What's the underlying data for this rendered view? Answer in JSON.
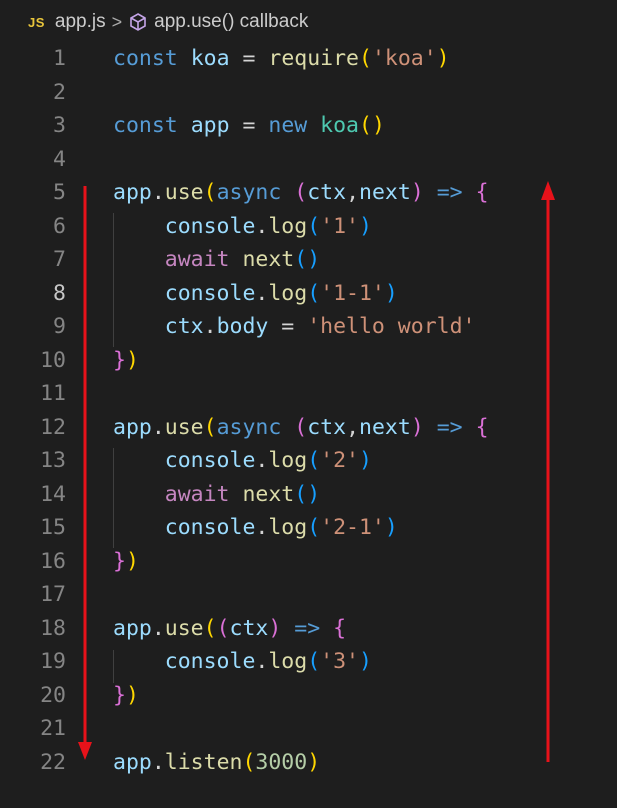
{
  "breadcrumb": {
    "language_badge": "JS",
    "file": "app.js",
    "separator": ">",
    "symbol": "app.use() callback",
    "symbol_icon": "cube-icon"
  },
  "lines": [
    {
      "n": "1",
      "active": false,
      "tokens": [
        [
          "kw",
          "const"
        ],
        [
          "plain",
          " "
        ],
        [
          "var",
          "koa"
        ],
        [
          "plain",
          " = "
        ],
        [
          "fn",
          "require"
        ],
        [
          "p1",
          "("
        ],
        [
          "str",
          "'koa'"
        ],
        [
          "p1",
          ")"
        ]
      ]
    },
    {
      "n": "2",
      "active": false,
      "tokens": []
    },
    {
      "n": "3",
      "active": false,
      "tokens": [
        [
          "kw",
          "const"
        ],
        [
          "plain",
          " "
        ],
        [
          "var",
          "app"
        ],
        [
          "plain",
          " = "
        ],
        [
          "kw",
          "new"
        ],
        [
          "plain",
          " "
        ],
        [
          "cls",
          "koa"
        ],
        [
          "p1",
          "()"
        ]
      ]
    },
    {
      "n": "4",
      "active": false,
      "tokens": []
    },
    {
      "n": "5",
      "active": false,
      "tokens": [
        [
          "var",
          "app"
        ],
        [
          "plain",
          "."
        ],
        [
          "fn",
          "use"
        ],
        [
          "p1",
          "("
        ],
        [
          "kw",
          "async"
        ],
        [
          "plain",
          " "
        ],
        [
          "p2",
          "("
        ],
        [
          "var",
          "ctx"
        ],
        [
          "plain",
          ","
        ],
        [
          "var",
          "next"
        ],
        [
          "p2",
          ")"
        ],
        [
          "plain",
          " "
        ],
        [
          "kw",
          "=>"
        ],
        [
          "plain",
          " "
        ],
        [
          "p2",
          "{"
        ]
      ]
    },
    {
      "n": "6",
      "active": false,
      "tokens": [
        [
          "plain",
          "    "
        ],
        [
          "var",
          "console"
        ],
        [
          "plain",
          "."
        ],
        [
          "fn",
          "log"
        ],
        [
          "p3",
          "("
        ],
        [
          "str",
          "'1'"
        ],
        [
          "p3",
          ")"
        ]
      ]
    },
    {
      "n": "7",
      "active": false,
      "tokens": [
        [
          "plain",
          "    "
        ],
        [
          "kw2",
          "await"
        ],
        [
          "plain",
          " "
        ],
        [
          "fn",
          "next"
        ],
        [
          "p3",
          "()"
        ]
      ]
    },
    {
      "n": "8",
      "active": true,
      "tokens": [
        [
          "plain",
          "    "
        ],
        [
          "var",
          "console"
        ],
        [
          "plain",
          "."
        ],
        [
          "fn",
          "log"
        ],
        [
          "p3",
          "("
        ],
        [
          "str",
          "'1-1'"
        ],
        [
          "p3",
          ")"
        ]
      ]
    },
    {
      "n": "9",
      "active": false,
      "tokens": [
        [
          "plain",
          "    "
        ],
        [
          "var",
          "ctx"
        ],
        [
          "plain",
          "."
        ],
        [
          "var",
          "body"
        ],
        [
          "plain",
          " = "
        ],
        [
          "str",
          "'hello world'"
        ]
      ]
    },
    {
      "n": "10",
      "active": false,
      "tokens": [
        [
          "p2",
          "}"
        ],
        [
          "p1",
          ")"
        ]
      ]
    },
    {
      "n": "11",
      "active": false,
      "tokens": []
    },
    {
      "n": "12",
      "active": false,
      "tokens": [
        [
          "var",
          "app"
        ],
        [
          "plain",
          "."
        ],
        [
          "fn",
          "use"
        ],
        [
          "p1",
          "("
        ],
        [
          "kw",
          "async"
        ],
        [
          "plain",
          " "
        ],
        [
          "p2",
          "("
        ],
        [
          "var",
          "ctx"
        ],
        [
          "plain",
          ","
        ],
        [
          "var",
          "next"
        ],
        [
          "p2",
          ")"
        ],
        [
          "plain",
          " "
        ],
        [
          "kw",
          "=>"
        ],
        [
          "plain",
          " "
        ],
        [
          "p2",
          "{"
        ]
      ]
    },
    {
      "n": "13",
      "active": false,
      "tokens": [
        [
          "plain",
          "    "
        ],
        [
          "var",
          "console"
        ],
        [
          "plain",
          "."
        ],
        [
          "fn",
          "log"
        ],
        [
          "p3",
          "("
        ],
        [
          "str",
          "'2'"
        ],
        [
          "p3",
          ")"
        ]
      ]
    },
    {
      "n": "14",
      "active": false,
      "tokens": [
        [
          "plain",
          "    "
        ],
        [
          "kw2",
          "await"
        ],
        [
          "plain",
          " "
        ],
        [
          "fn",
          "next"
        ],
        [
          "p3",
          "()"
        ]
      ]
    },
    {
      "n": "15",
      "active": false,
      "tokens": [
        [
          "plain",
          "    "
        ],
        [
          "var",
          "console"
        ],
        [
          "plain",
          "."
        ],
        [
          "fn",
          "log"
        ],
        [
          "p3",
          "("
        ],
        [
          "str",
          "'2-1'"
        ],
        [
          "p3",
          ")"
        ]
      ]
    },
    {
      "n": "16",
      "active": false,
      "tokens": [
        [
          "p2",
          "}"
        ],
        [
          "p1",
          ")"
        ]
      ]
    },
    {
      "n": "17",
      "active": false,
      "tokens": []
    },
    {
      "n": "18",
      "active": false,
      "tokens": [
        [
          "var",
          "app"
        ],
        [
          "plain",
          "."
        ],
        [
          "fn",
          "use"
        ],
        [
          "p1",
          "("
        ],
        [
          "p2",
          "("
        ],
        [
          "var",
          "ctx"
        ],
        [
          "p2",
          ")"
        ],
        [
          "plain",
          " "
        ],
        [
          "kw",
          "=>"
        ],
        [
          "plain",
          " "
        ],
        [
          "p2",
          "{"
        ]
      ]
    },
    {
      "n": "19",
      "active": false,
      "tokens": [
        [
          "plain",
          "    "
        ],
        [
          "var",
          "console"
        ],
        [
          "plain",
          "."
        ],
        [
          "fn",
          "log"
        ],
        [
          "p3",
          "("
        ],
        [
          "str",
          "'3'"
        ],
        [
          "p3",
          ")"
        ]
      ]
    },
    {
      "n": "20",
      "active": false,
      "tokens": [
        [
          "p2",
          "}"
        ],
        [
          "p1",
          ")"
        ]
      ]
    },
    {
      "n": "21",
      "active": false,
      "tokens": []
    },
    {
      "n": "22",
      "active": false,
      "tokens": [
        [
          "var",
          "app"
        ],
        [
          "plain",
          "."
        ],
        [
          "fn",
          "listen"
        ],
        [
          "p1",
          "("
        ],
        [
          "num",
          "3000"
        ],
        [
          "p1",
          ")"
        ]
      ]
    }
  ],
  "annotations": {
    "down_arrow_color": "#e8121a",
    "up_arrow_color": "#e8121a"
  }
}
